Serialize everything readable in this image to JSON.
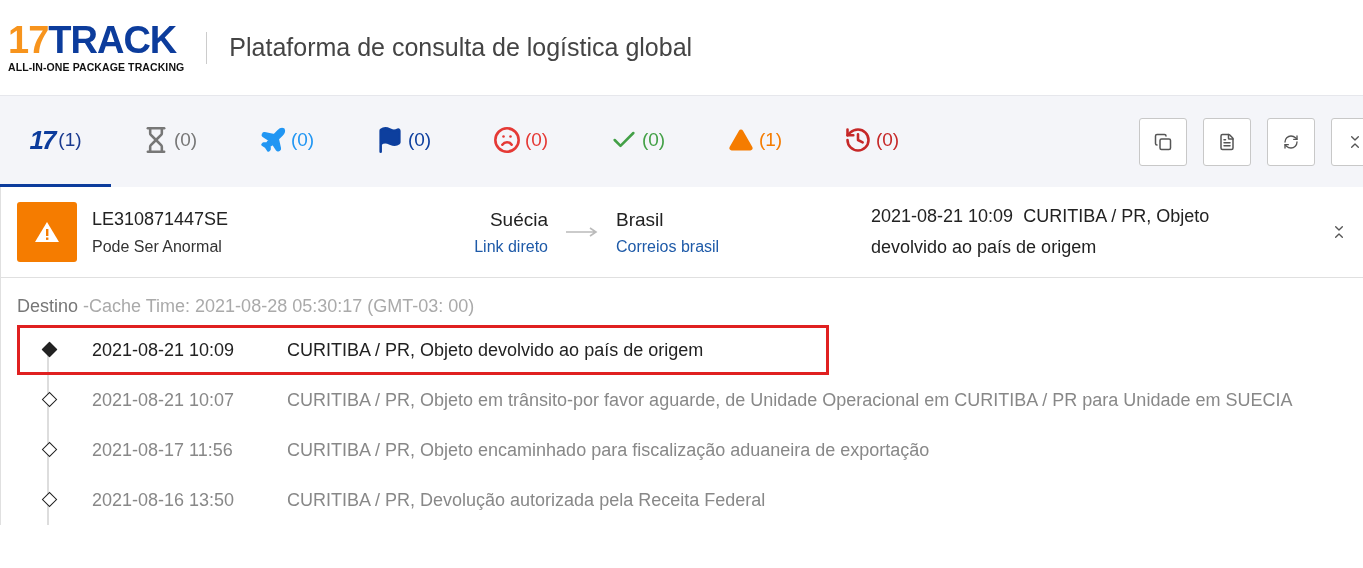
{
  "header": {
    "logo": {
      "number": "17",
      "word": "TRACK",
      "tagline": "ALL-IN-ONE PACKAGE TRACKING"
    },
    "title": "Plataforma de consulta de logística global"
  },
  "tabs": [
    {
      "kind": "all",
      "mark": "17",
      "count": "(1)",
      "selected": true
    },
    {
      "kind": "pending",
      "count": "(0)",
      "selected": false
    },
    {
      "kind": "transit",
      "count": "(0)",
      "selected": false
    },
    {
      "kind": "pickup",
      "count": "(0)",
      "selected": false
    },
    {
      "kind": "undelivered",
      "count": "(0)",
      "selected": false
    },
    {
      "kind": "delivered",
      "count": "(0)",
      "selected": false
    },
    {
      "kind": "alert",
      "count": "(1)",
      "selected": false
    },
    {
      "kind": "expired",
      "count": "(0)",
      "selected": false
    }
  ],
  "shipment": {
    "tracking_number": "LE310871447SE",
    "status": "Pode Ser Anormal",
    "origin": {
      "country": "Suécia",
      "link": "Link direto"
    },
    "destination": {
      "country": "Brasil",
      "link": "Correios brasil"
    },
    "latest_time": "2021-08-21 10:09",
    "latest_event": "CURITIBA / PR, Objeto devolvido ao país de origem",
    "expanded": true
  },
  "timeline": {
    "section_label": "Destino",
    "cache_time": "-Cache Time: 2021-08-28 05:30:17 (GMT-03: 00)",
    "events": [
      {
        "time": "2021-08-21 10:09",
        "text": "CURITIBA / PR, Objeto devolvido ao país de origem",
        "current": true,
        "highlighted": true
      },
      {
        "time": "2021-08-21 10:07",
        "text": "CURITIBA / PR, Objeto em trânsito-por favor aguarde, de Unidade Operacional em CURITIBA / PR para Unidade em SUECIA",
        "current": false,
        "highlighted": false
      },
      {
        "time": "2021-08-17 11:56",
        "text": "CURITIBA / PR, Objeto encaminhado para fiscalização aduaneira de exportação",
        "current": false,
        "highlighted": false
      },
      {
        "time": "2021-08-16 13:50",
        "text": "CURITIBA / PR, Devolução autorizada pela Receita Federal",
        "current": false,
        "highlighted": false
      }
    ]
  }
}
